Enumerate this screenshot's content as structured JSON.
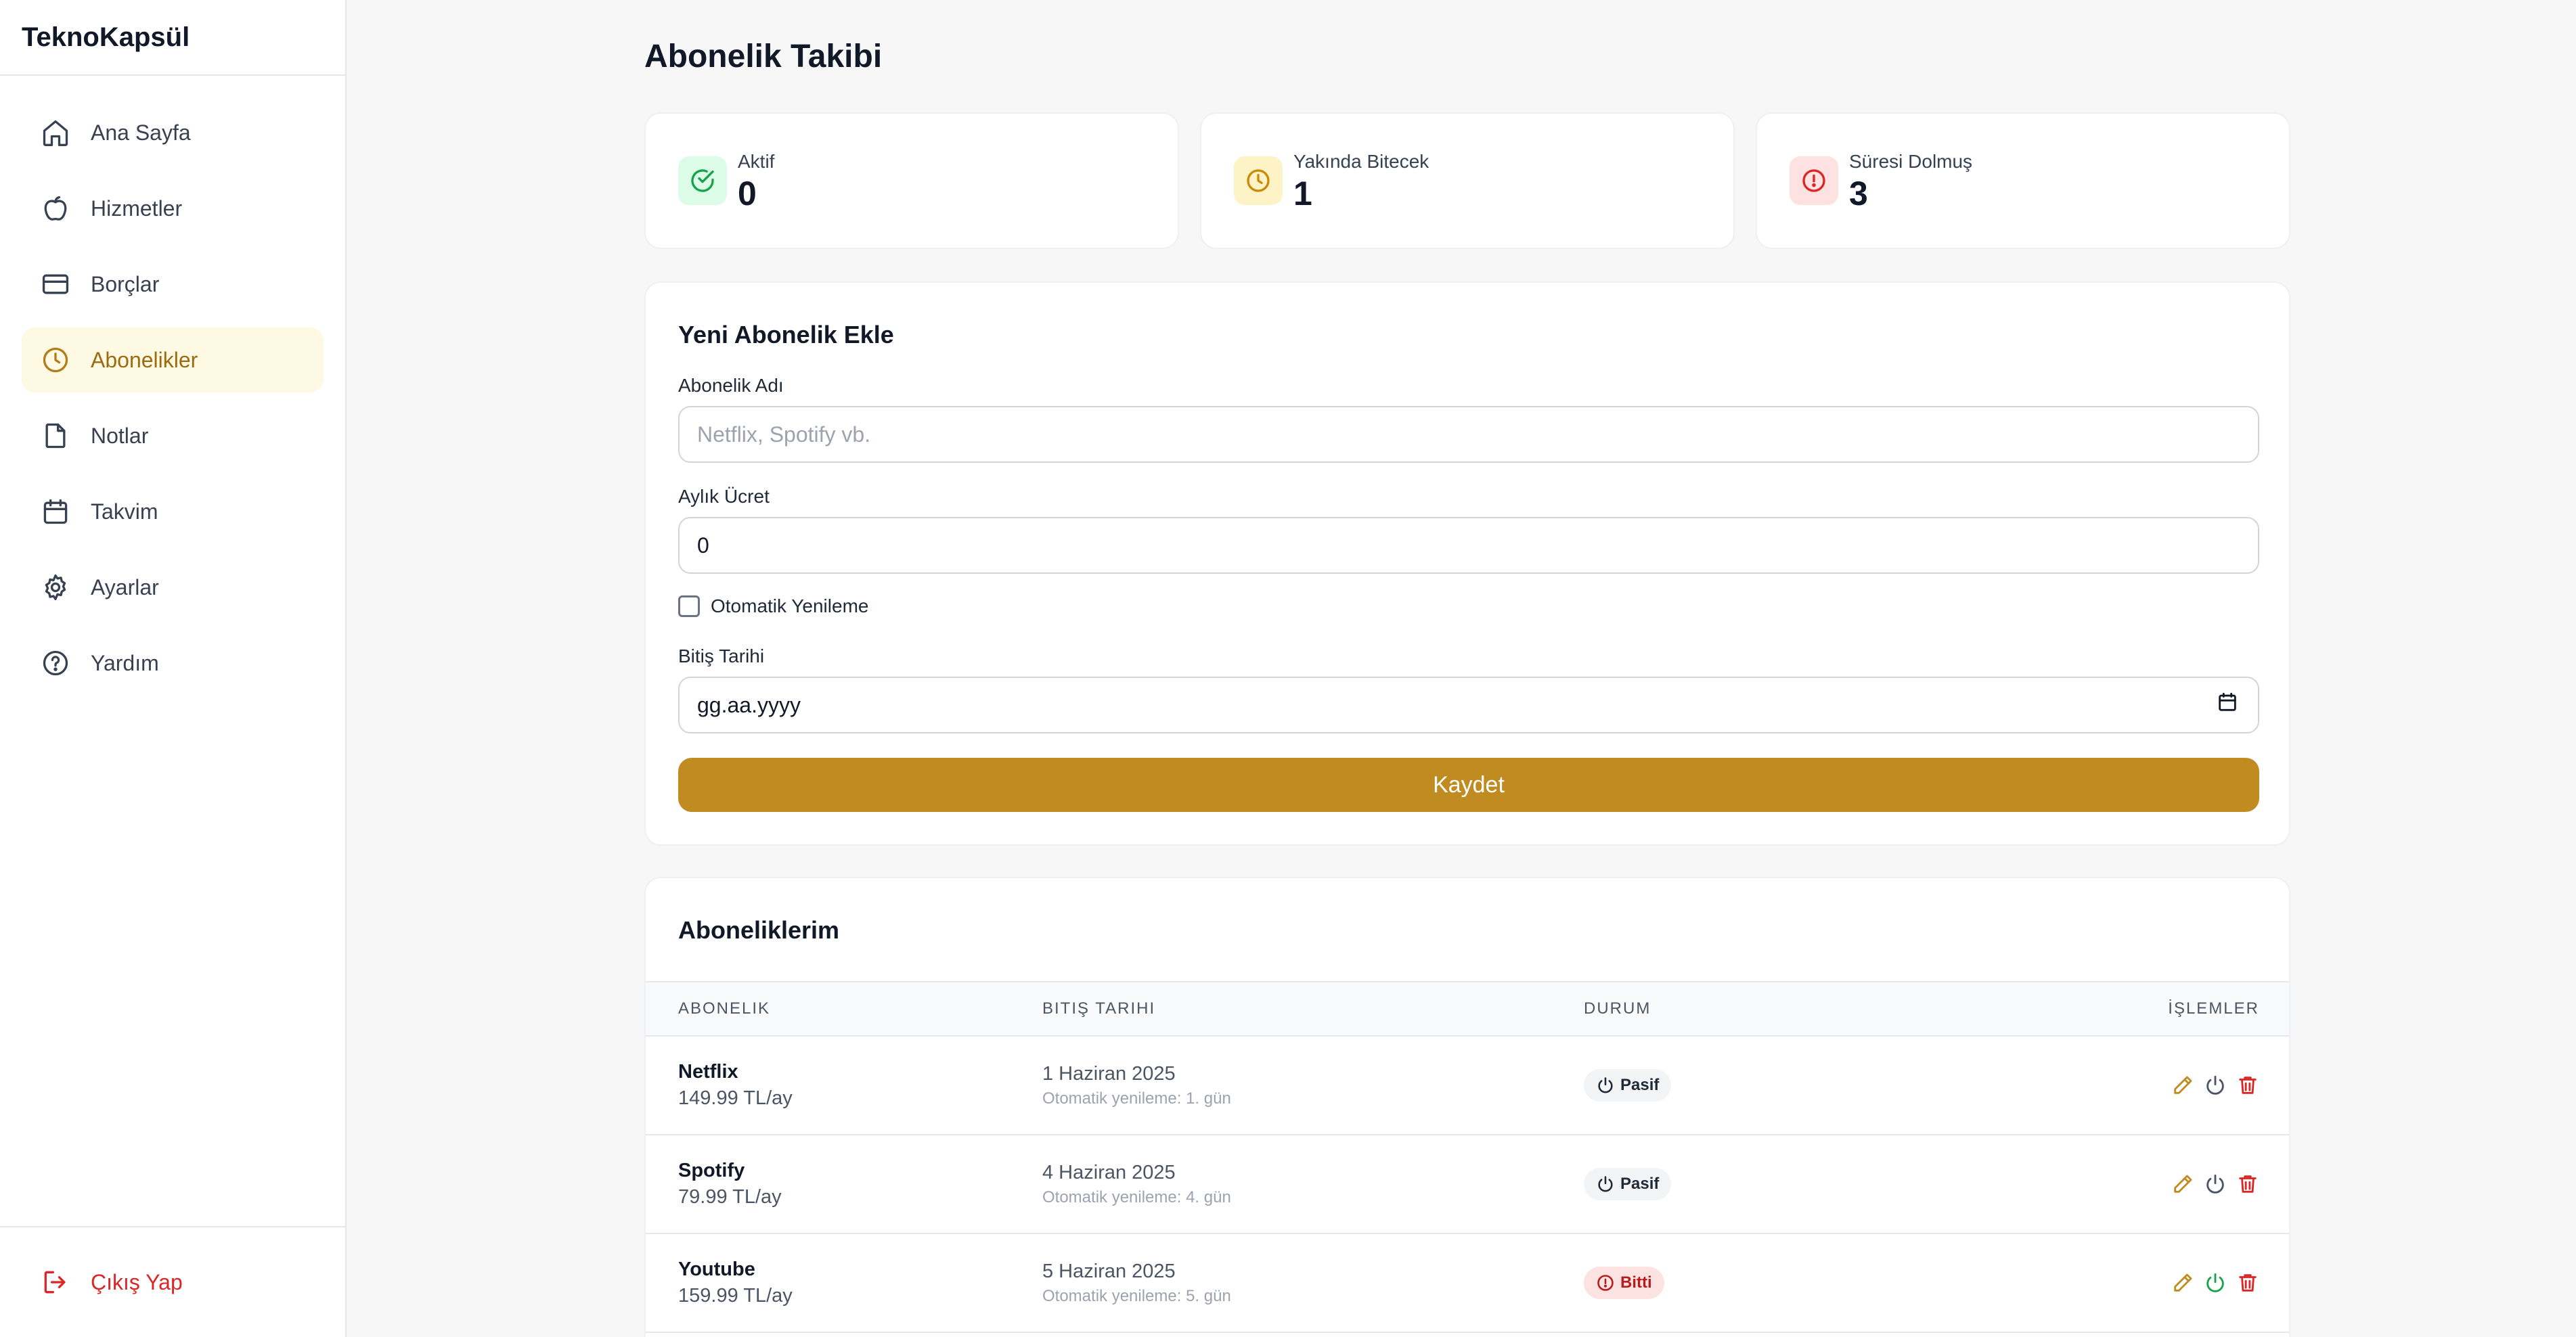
{
  "app": {
    "brand": "TeknoKapsül"
  },
  "sidebar": {
    "items": [
      {
        "label": "Ana Sayfa",
        "icon": "home-icon"
      },
      {
        "label": "Hizmetler",
        "icon": "apple-icon"
      },
      {
        "label": "Borçlar",
        "icon": "credit-card-icon"
      },
      {
        "label": "Abonelikler",
        "icon": "clock-icon",
        "active": true
      },
      {
        "label": "Notlar",
        "icon": "file-icon"
      },
      {
        "label": "Takvim",
        "icon": "calendar-icon"
      },
      {
        "label": "Ayarlar",
        "icon": "gear-icon"
      },
      {
        "label": "Yardım",
        "icon": "help-circle-icon"
      }
    ],
    "logout": "Çıkış Yap"
  },
  "page": {
    "title": "Abonelik Takibi"
  },
  "stats": [
    {
      "label": "Aktif",
      "value": "0",
      "color": "#16a34a",
      "bg": "#dcfce7"
    },
    {
      "label": "Yakında Bitecek",
      "value": "1",
      "color": "#ca8a04",
      "bg": "#fef3c7"
    },
    {
      "label": "Süresi Dolmuş",
      "value": "3",
      "color": "#dc2626",
      "bg": "#fee2e2"
    }
  ],
  "form": {
    "title": "Yeni Abonelik Ekle",
    "name_label": "Abonelik Adı",
    "name_placeholder": "Netflix, Spotify vb.",
    "fee_label": "Aylık Ücret",
    "fee_value": "0",
    "auto_renew_label": "Otomatik Yenileme",
    "auto_renew_checked": false,
    "end_date_label": "Bitiş Tarihi",
    "end_date_placeholder": "gg.aa.yyyy",
    "save_label": "Kaydet",
    "accent": "#c08c22"
  },
  "list": {
    "title": "Aboneliklerim",
    "headers": [
      "ABONELIK",
      "BITIŞ TARIHI",
      "DURUM",
      "İŞLEMLER"
    ],
    "rows": [
      {
        "name": "Netflix",
        "price": "149.99 TL/ay",
        "date": "1 Haziran 2025",
        "renew": "Otomatik yenileme: 1. gün",
        "status": "Pasif",
        "status_type": "pasif"
      },
      {
        "name": "Spotify",
        "price": "79.99 TL/ay",
        "date": "4 Haziran 2025",
        "renew": "Otomatik yenileme: 4. gün",
        "status": "Pasif",
        "status_type": "pasif"
      },
      {
        "name": "Youtube",
        "price": "159.99 TL/ay",
        "date": "5 Haziran 2025",
        "renew": "Otomatik yenileme: 5. gün",
        "status": "Bitti",
        "status_type": "bitti"
      }
    ]
  }
}
